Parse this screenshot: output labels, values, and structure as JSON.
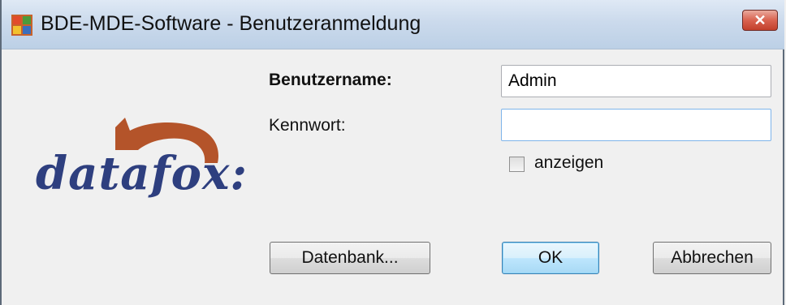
{
  "window": {
    "title": "BDE-MDE-Software - Benutzeranmeldung",
    "close_glyph": "✕",
    "app_icon": "app-icon"
  },
  "logo": {
    "text": "datafox:",
    "colors": {
      "text": "#2e3f7f",
      "fox": "#b4542a",
      "dots": "#e88a2b"
    }
  },
  "form": {
    "username_label": "Benutzername:",
    "username_value": "Admin",
    "password_label": "Kennwort:",
    "password_value": "",
    "show_checkbox_label": "anzeigen",
    "show_checked": false
  },
  "buttons": {
    "database": "Datenbank...",
    "ok": "OK",
    "cancel": "Abbrechen"
  }
}
